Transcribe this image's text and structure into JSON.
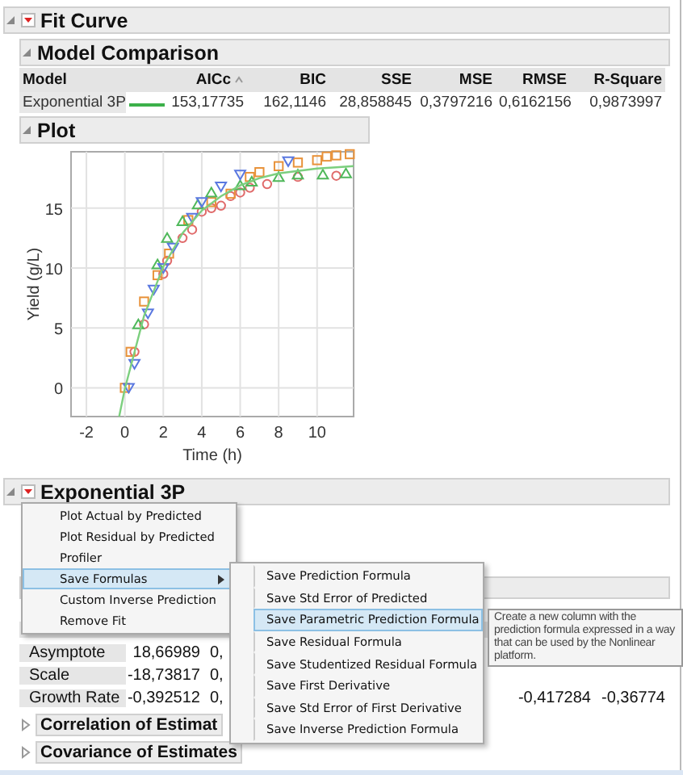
{
  "fit_curve": {
    "title": "Fit Curve"
  },
  "model_comparison": {
    "title": "Model Comparison",
    "columns": [
      "Model",
      "",
      "AICc",
      "BIC",
      "SSE",
      "MSE",
      "RMSE",
      "R-Square"
    ],
    "rows": [
      {
        "model": "Exponential 3P",
        "color": "#3cb04a",
        "values": [
          "153,17735",
          "162,1146",
          "28,858845",
          "0,3797216",
          "0,6162156",
          "0,9873997"
        ]
      }
    ]
  },
  "plot": {
    "title": "Plot",
    "chart_data": {
      "type": "scatter",
      "xlabel": "Time (h)",
      "ylabel": "Yield (g/L)",
      "xlim": [
        -2.8,
        11.9
      ],
      "ylim": [
        -2.4,
        19.7
      ],
      "xticks": [
        -2,
        0,
        2,
        4,
        6,
        8,
        10
      ],
      "yticks": [
        0,
        5,
        10,
        15
      ],
      "grid": true,
      "series": [
        {
          "color": "#e06a6a",
          "x": [
            0.5,
            1,
            2,
            2.2,
            3,
            3.5,
            4,
            4.5,
            5,
            5.5,
            6,
            6.5,
            7.4,
            9,
            11
          ],
          "values": [
            3,
            5.3,
            9.5,
            10.6,
            12.5,
            13.2,
            14.7,
            15,
            15.2,
            16,
            16.3,
            16.7,
            17,
            17.6,
            17.7
          ]
        },
        {
          "color": "#e8923a",
          "x": [
            0,
            0.3,
            1,
            1.7,
            2.3,
            3.3,
            4.5,
            5.5,
            6.5,
            7,
            8,
            9,
            10,
            10.5,
            11,
            11.7
          ],
          "values": [
            0,
            3,
            7.2,
            9.4,
            11.2,
            14,
            15.5,
            16.2,
            17.6,
            18,
            18.5,
            18.8,
            19,
            19.3,
            19.4,
            19.5
          ]
        },
        {
          "color": "#4fb85a",
          "x": [
            0.7,
            1.7,
            2.2,
            3,
            3.8,
            4.5,
            6,
            6.6,
            8,
            9,
            10.3,
            11.5
          ],
          "values": [
            5.3,
            10.3,
            12.5,
            13.9,
            15.3,
            16.3,
            16.9,
            17.2,
            17.6,
            17.8,
            17.8,
            17.9
          ]
        },
        {
          "color": "#5a78e0",
          "x": [
            0.2,
            0.5,
            1.2,
            1.5,
            2,
            2.5,
            3.5,
            4,
            5,
            6,
            8.5
          ],
          "values": [
            0,
            2,
            6.2,
            8.2,
            10,
            11.7,
            14.2,
            15.5,
            16.8,
            17.8,
            18.9
          ]
        },
        {
          "type": "line",
          "color": "#7ccf7e",
          "x": [
            -0.3,
            0,
            1,
            2,
            3,
            4,
            5,
            6,
            7,
            8,
            9,
            10,
            11,
            11.9
          ],
          "values": [
            -2.4,
            -0.1,
            6,
            10.1,
            12.9,
            14.8,
            16,
            16.9,
            17.5,
            17.9,
            18.1,
            18.3,
            18.4,
            18.5
          ]
        }
      ]
    }
  },
  "exponential": {
    "title": "Exponential 3P",
    "params": [
      {
        "name": "Asymptote",
        "estimate": "18,66989",
        "std_error": "0,"
      },
      {
        "name": "Scale",
        "estimate": "-18,73817",
        "std_error": "0,"
      },
      {
        "name": "Growth Rate",
        "estimate": "-0,392512",
        "std_error": "0,",
        "lower": "-0,417284",
        "upper": "-0,36774"
      }
    ],
    "sections": [
      {
        "title": "Correlation of Estimat",
        "expanded": false
      },
      {
        "title": "Covariance of Estimates",
        "expanded": false
      }
    ]
  },
  "menu": [
    {
      "label": "Plot Actual by Predicted",
      "selected": false,
      "submenu": false
    },
    {
      "label": "Plot Residual by Predicted",
      "selected": false,
      "submenu": false
    },
    {
      "label": "Profiler",
      "selected": false,
      "submenu": false
    },
    {
      "label": "Save Formulas",
      "selected": true,
      "submenu": true
    },
    {
      "label": "Custom Inverse Prediction",
      "selected": false,
      "submenu": false
    },
    {
      "label": "Remove Fit",
      "selected": false,
      "submenu": false
    }
  ],
  "submenu": [
    {
      "label": "Save Prediction Formula",
      "selected": false
    },
    {
      "label": "Save Std Error of Predicted",
      "selected": false
    },
    {
      "label": "Save Parametric Prediction Formula",
      "selected": true
    },
    {
      "label": "Save Residual Formula",
      "selected": false
    },
    {
      "label": "Save Studentized Residual Formula",
      "selected": false
    },
    {
      "label": "Save First Derivative",
      "selected": false
    },
    {
      "label": "Save Std Error of First Derivative",
      "selected": false
    },
    {
      "label": "Save Inverse Prediction Formula",
      "selected": false
    }
  ],
  "tooltip": "Create a new column with the prediction formula expressed in a way that can be used by the Nonlinear platform."
}
